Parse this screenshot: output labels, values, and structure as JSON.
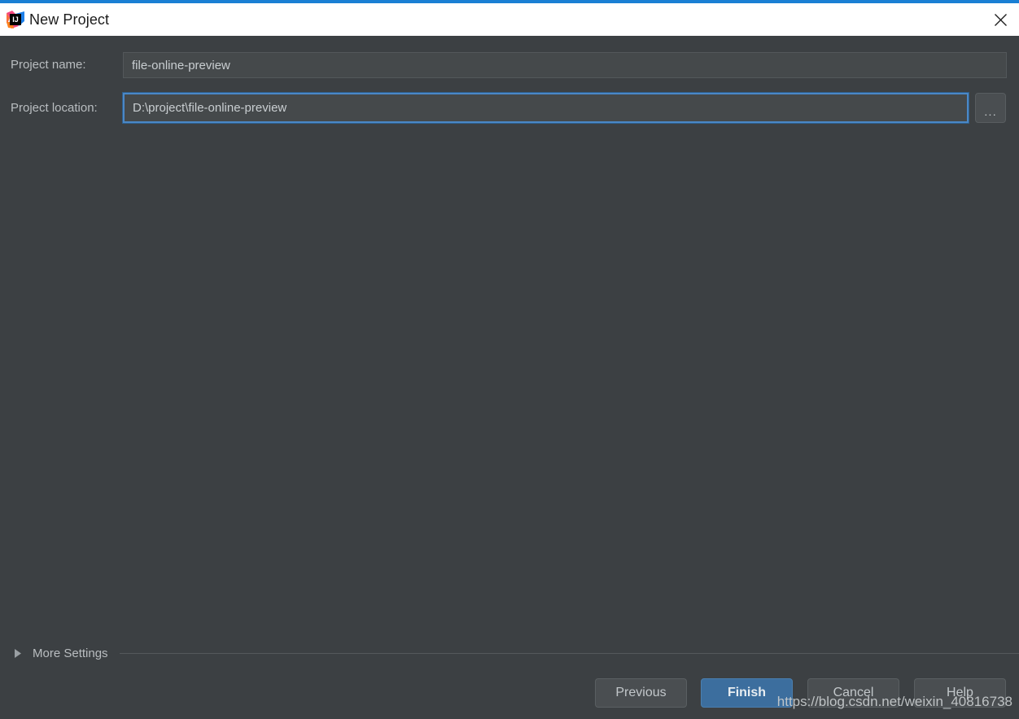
{
  "window": {
    "title": "New Project",
    "app_icon": "intellij-idea-logo",
    "close_icon": "close-icon",
    "accent_color": "#1a7fd4",
    "background_color": "#3c4043",
    "titlebar_color": "#ffffff"
  },
  "form": {
    "project_name": {
      "label": "Project name:",
      "value": "file-online-preview",
      "placeholder": ""
    },
    "project_location": {
      "label": "Project location:",
      "value": "D:\\project\\file-online-preview",
      "placeholder": "",
      "browse_label": "...",
      "browse_icon": "ellipsis-icon"
    }
  },
  "more_settings": {
    "label": "More Settings",
    "expanded": false,
    "arrow_icon": "chevron-right-icon"
  },
  "buttons": {
    "previous": "Previous",
    "finish": "Finish",
    "cancel": "Cancel",
    "help": "Help",
    "primary_color": "#3c6e9e"
  },
  "watermark": {
    "text": "https://blog.csdn.net/weixin_40816738"
  }
}
